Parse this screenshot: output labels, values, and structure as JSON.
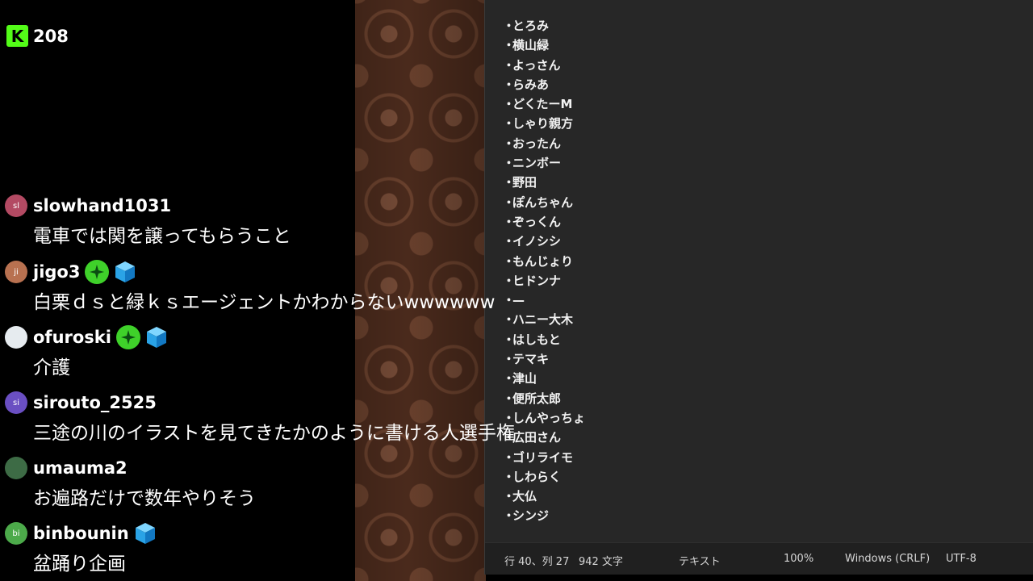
{
  "viewer_count": {
    "logo": "K",
    "count": "208"
  },
  "chat": [
    {
      "user": "slowhand1031",
      "initials": "sl",
      "avatar_color": "#b34a63",
      "message": "電車では関を譲ってもらうこと",
      "badges": []
    },
    {
      "user": "jigo3",
      "initials": "ji",
      "avatar_color": "#b87150",
      "message": "白栗ｄｓと緑ｋｓエージェントかわからないwwwwww",
      "badges": [
        "star-badge-icon",
        "cube-badge-icon"
      ]
    },
    {
      "user": "ofuroski",
      "initials": "",
      "avatar_color": "#e6ebef",
      "message": "介護",
      "badges": [
        "star-badge-icon",
        "cube-badge-icon"
      ]
    },
    {
      "user": "sirouto_2525",
      "initials": "si",
      "avatar_color": "#6a4fc2",
      "message": "三途の川のイラストを見てきたかのように書ける人選手権",
      "badges": []
    },
    {
      "user": "umauma2",
      "initials": "",
      "avatar_color": "#3d6b45",
      "message": "お遍路だけで数年やりそう",
      "badges": []
    },
    {
      "user": "binbounin",
      "initials": "bi",
      "avatar_color": "#4caa4a",
      "message": "盆踊り企画",
      "badges": [
        "cube-badge-icon"
      ]
    }
  ],
  "editor": {
    "bullet": "・",
    "lines": [
      "とろみ",
      "横山緑",
      "よっさん",
      "らみあ",
      "どくたーM",
      "しゃり親方",
      "おったん",
      "ニンボー",
      "野田",
      "ぽんちゃん",
      "ぞっくん",
      "イノシシ",
      "もんじょり",
      "ヒドンナ",
      "—",
      "ハニー大木",
      "はしもと",
      "テマキ",
      "津山",
      "便所太郎",
      "しんやっちょ",
      "広田さん",
      "ゴリライモ",
      "しわらく",
      "大仏",
      "シンジ"
    ]
  },
  "statusbar": {
    "position": "行 40、列 27",
    "chars": "942 文字",
    "format": "テキスト",
    "zoom": "100%",
    "line_ending": "Windows (CRLF)",
    "encoding": "UTF-8"
  },
  "colors": {
    "kick_green": "#53fc18",
    "notepad_bg": "#272727",
    "wallpaper": "#4a2a1c"
  }
}
